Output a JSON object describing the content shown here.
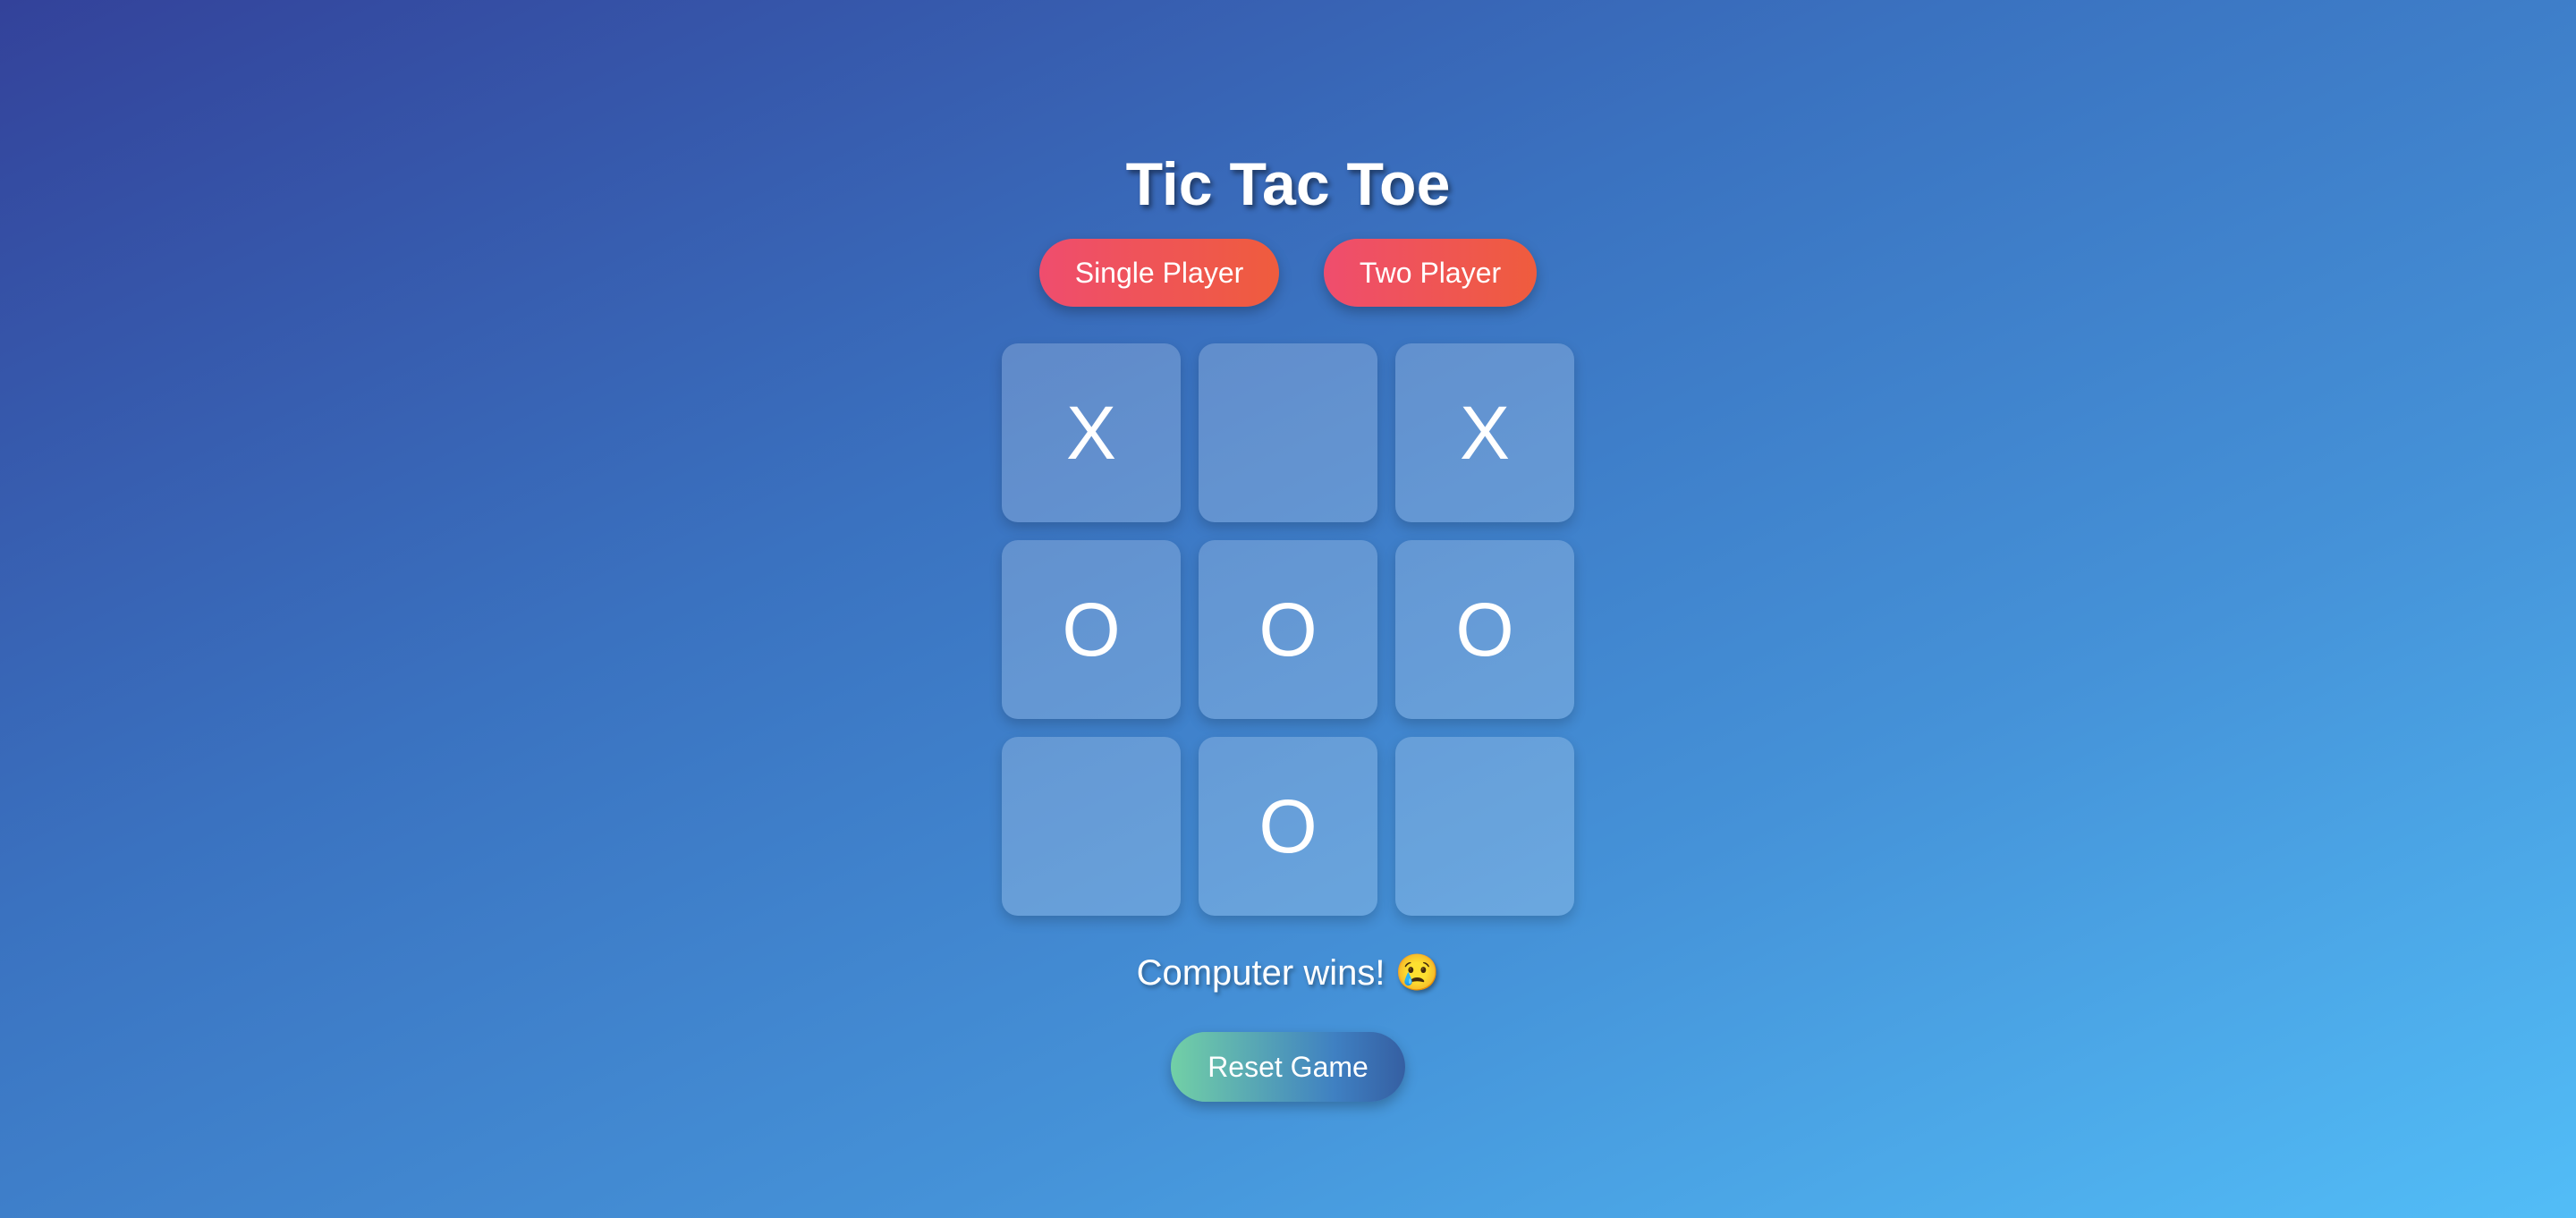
{
  "title": "Tic Tac Toe",
  "modes": {
    "single_label": "Single Player",
    "two_label": "Two Player"
  },
  "board": {
    "cells": [
      "X",
      "",
      "X",
      "O",
      "O",
      "O",
      "",
      "O",
      ""
    ]
  },
  "status": "Computer wins! 😢",
  "reset_label": "Reset Game",
  "colors": {
    "background_start": "#33429a",
    "background_end": "#52bdf7",
    "mode_button": "#ef5466",
    "reset_button_start": "#72d0a6",
    "reset_button_end": "#355fa2"
  }
}
